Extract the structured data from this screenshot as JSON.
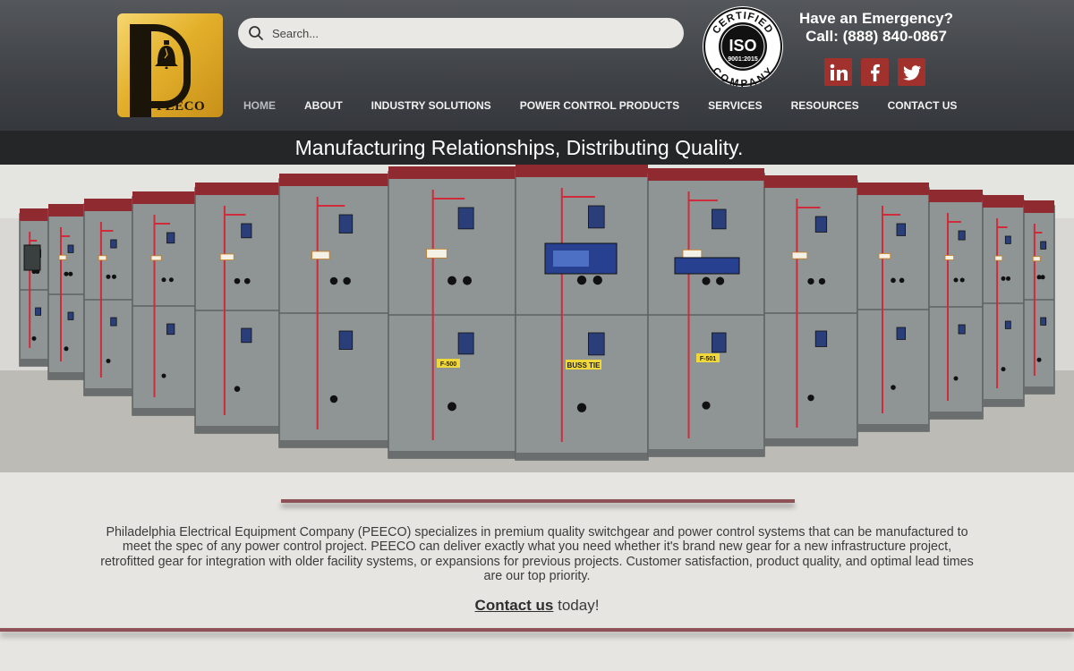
{
  "brand": {
    "logo_text": "PEECO",
    "colors": {
      "header": "#3f4246",
      "accent": "#a0312d",
      "divider": "#8d5157",
      "logo_gold": "#e3b02a"
    }
  },
  "search": {
    "placeholder": "Search...",
    "value": ""
  },
  "nav": {
    "items": [
      {
        "label": "HOME",
        "active": true
      },
      {
        "label": "ABOUT"
      },
      {
        "label": "INDUSTRY SOLUTIONS"
      },
      {
        "label": "POWER CONTROL PRODUCTS"
      },
      {
        "label": "SERVICES"
      },
      {
        "label": "RESOURCES"
      },
      {
        "label": "CONTACT US"
      }
    ]
  },
  "certification": {
    "top": "CERTIFIED",
    "center": "ISO",
    "number": "9001:2015",
    "bottom": "COMPANY"
  },
  "emergency": {
    "line1": "Have an Emergency?",
    "line2": "Call: (888) 840-0867"
  },
  "social": [
    {
      "name": "linkedin",
      "icon": "linkedin-icon"
    },
    {
      "name": "facebook",
      "icon": "facebook-icon"
    },
    {
      "name": "twitter",
      "icon": "twitter-icon"
    }
  ],
  "tagline": "Manufacturing Relationships, Distributing Quality.",
  "hero_labels": {
    "buss_tie": "BUSS TIE",
    "f500": "F-500",
    "f501": "F-501"
  },
  "about": {
    "text": "Philadelphia Electrical Equipment Company (PEECO) specializes in premium quality switchgear and power control systems that can be manufactured to meet the spec of any power control project. PEECO can deliver exactly what you need whether it's brand new gear for a new infrastructure project, retrofitted gear for integration with older facility systems, or expansions for previous projects. Customer satisfaction, product quality, and optimal lead times are our top priority.",
    "contact_link": "Contact us",
    "contact_suffix": " today!"
  }
}
